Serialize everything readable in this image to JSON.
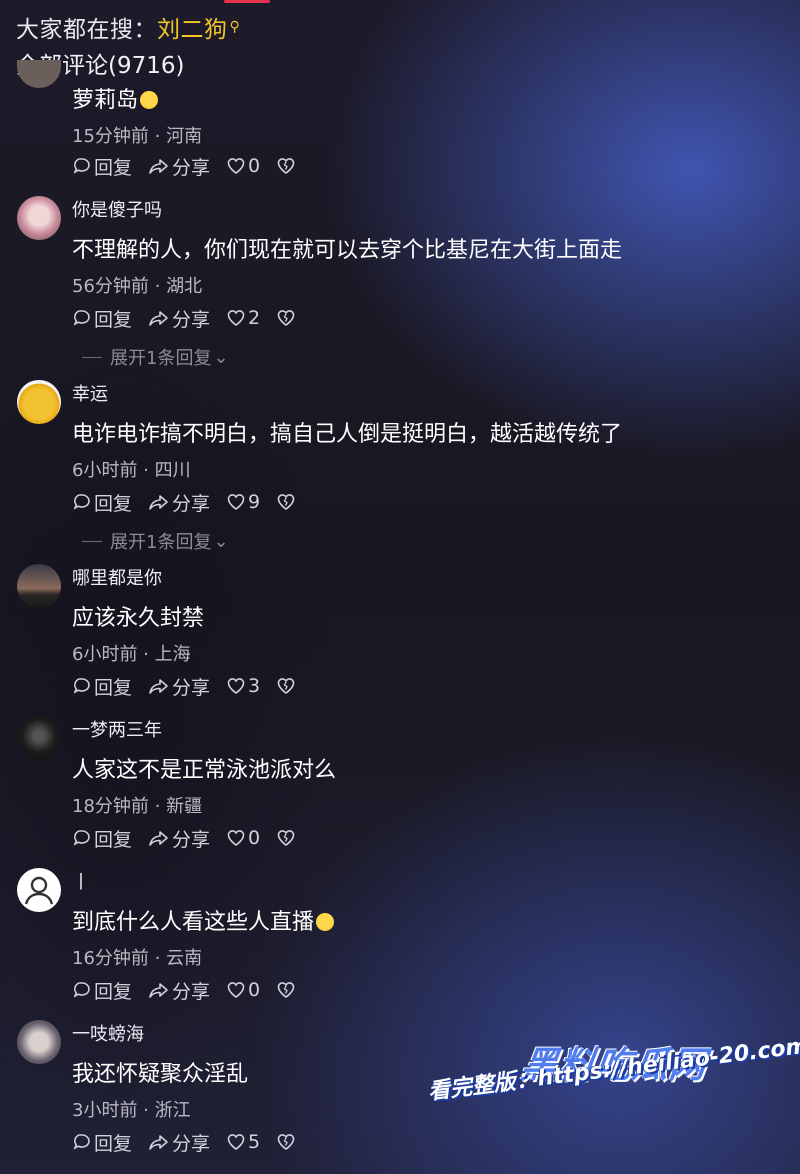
{
  "header": {
    "search_prefix": "大家都在搜：",
    "search_term": "刘二狗",
    "comment_count_label": "全部评论(9716)"
  },
  "actions": {
    "reply": "回复",
    "share": "分享"
  },
  "comments": [
    {
      "username": "",
      "text": "萝莉岛",
      "emoji": "laughing-emoji",
      "time_location": "15分钟前 · 河南",
      "likes": "0",
      "expand": ""
    },
    {
      "username": "你是傻子吗",
      "text": "不理解的人，你们现在就可以去穿个比基尼在大街上面走",
      "time_location": "56分钟前 · 湖北",
      "likes": "2",
      "expand": "展开1条回复"
    },
    {
      "username": "幸运",
      "text": "电诈电诈搞不明白，搞自己人倒是挺明白，越活越传统了",
      "time_location": "6小时前 · 四川",
      "likes": "9",
      "expand": "展开1条回复"
    },
    {
      "username": "哪里都是你",
      "text": "应该永久封禁",
      "time_location": "6小时前 · 上海",
      "likes": "3",
      "expand": ""
    },
    {
      "username": "一梦两三年",
      "text": "人家这不是正常泳池派对么",
      "time_location": "18分钟前 · 新疆",
      "likes": "0",
      "expand": ""
    },
    {
      "username": "丨",
      "text": "到底什么人看这些人直播",
      "emoji": "grimace-emoji",
      "time_location": "16分钟前 · 云南",
      "likes": "0",
      "expand": ""
    },
    {
      "username": "一吱螃海",
      "text": "我还怀疑聚众淫乱",
      "time_location": "3小时前 · 浙江",
      "likes": "5",
      "expand": ""
    }
  ],
  "watermark": {
    "brand": "黑料吃瓜网",
    "slogan": "看完整版：https://heiliao-20.com"
  },
  "colors": {
    "search_term": "#f3c52a",
    "accent_red": "#e8324b",
    "watermark_blue": "#4f7df0"
  }
}
